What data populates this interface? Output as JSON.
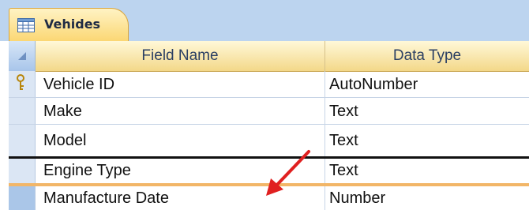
{
  "tab": {
    "label": "Vehides"
  },
  "columns": {
    "field_name": "Field Name",
    "data_type": "Data Type"
  },
  "rows": [
    {
      "field": "Vehicle ID",
      "type": "AutoNumber",
      "primary_key": true
    },
    {
      "field": "Make",
      "type": "Text"
    },
    {
      "field": "Model",
      "type": "Text"
    },
    {
      "field": "Engine Type",
      "type": "Text"
    },
    {
      "field": "Manufacture Date",
      "type": "Number"
    }
  ],
  "colors": {
    "tab": "#fbd774",
    "header": "#f3d889",
    "tabstrip": "#bcd4ef",
    "arrow": "#e02020"
  },
  "icons": {
    "tab_icon": "table-icon",
    "key_icon": "primary-key-icon",
    "arrow": "red-arrow-icon"
  }
}
